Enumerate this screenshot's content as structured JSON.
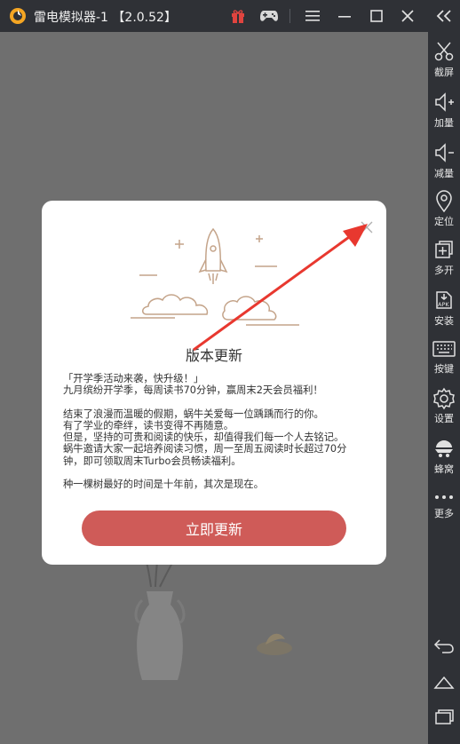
{
  "titlebar": {
    "app_title": "雷电模拟器-1 【2.0.52】",
    "icons": [
      "leidian-logo-icon",
      "gift-icon",
      "gamepad-icon",
      "menu-icon",
      "minimize-icon",
      "maximize-icon",
      "close-icon"
    ]
  },
  "sidebar": {
    "collapse_icon": "double-chevron-left-icon",
    "items": [
      {
        "label": "截屏",
        "icon": "scissors-icon"
      },
      {
        "label": "加量",
        "icon": "volume-up-icon"
      },
      {
        "label": "减量",
        "icon": "volume-down-icon"
      },
      {
        "label": "定位",
        "icon": "location-pin-icon"
      },
      {
        "label": "多开",
        "icon": "multi-window-icon"
      },
      {
        "label": "安装",
        "icon": "apk-install-icon"
      },
      {
        "label": "按键",
        "icon": "keyboard-icon"
      },
      {
        "label": "设置",
        "icon": "gear-icon"
      },
      {
        "label": "蜂窝",
        "icon": "hive-icon"
      },
      {
        "label": "更多",
        "icon": "more-dots-icon"
      }
    ],
    "nav_icons": [
      "back-icon",
      "home-icon",
      "recent-apps-icon"
    ]
  },
  "dialog": {
    "title": "版本更新",
    "body": [
      "「开学季活动来袭，快升级！」",
      "九月缤纷开学季，每周读书70分钟，赢周末2天会员福利！",
      "",
      "结束了浪漫而温暖的假期，蜗牛关爱每一位踽踽而行的你。",
      "有了学业的牵绊，读书变得不再随意。",
      "但是，坚持的可贵和阅读的快乐，却值得我们每一个人去铭记。",
      "蜗牛邀请大家一起培养阅读习惯，周一至周五阅读时长超过70分",
      "钟，即可领取周末Turbo会员畅读福利。",
      "",
      "种一棵树最好的时间是十年前，其次是现在。"
    ],
    "update_button": "立即更新",
    "close_icon": "close-x-icon"
  },
  "colors": {
    "titlebar_bg": "#2f3136",
    "overlay_bg": "#6f6f6f",
    "button_red": "#cf5b58",
    "arrow_red": "#e8382f"
  }
}
